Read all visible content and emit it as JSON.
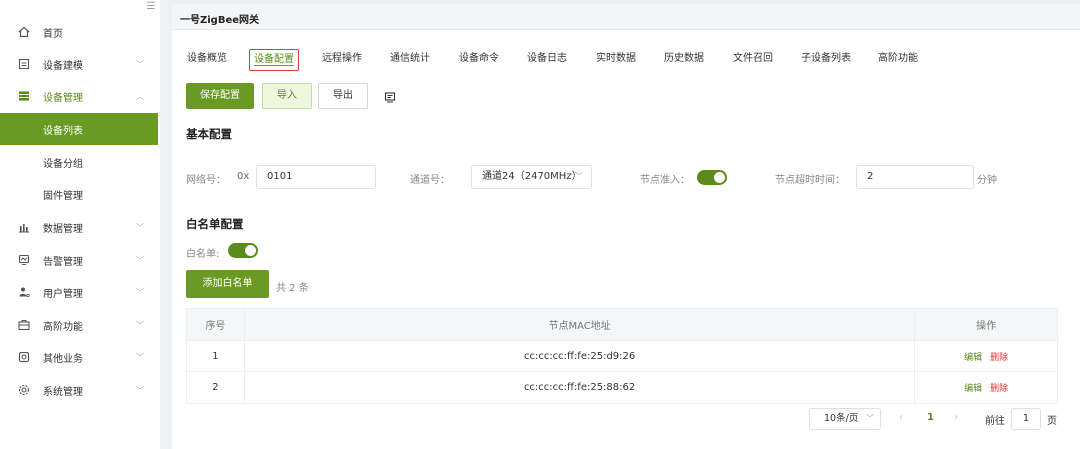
{
  "sidebar": {
    "collapse_glyph": "☰",
    "items": [
      {
        "label": "首页",
        "icon": "home-icon"
      },
      {
        "label": "设备建模",
        "icon": "model-icon"
      },
      {
        "label": "设备管理",
        "icon": "device-icon"
      },
      {
        "label": "数据管理",
        "icon": "chart-icon"
      },
      {
        "label": "告警管理",
        "icon": "alarm-icon"
      },
      {
        "label": "用户管理",
        "icon": "user-icon"
      },
      {
        "label": "高阶功能",
        "icon": "advanced-icon"
      },
      {
        "label": "其他业务",
        "icon": "other-icon"
      },
      {
        "label": "系统管理",
        "icon": "gear-icon"
      }
    ],
    "sub_items": [
      {
        "label": "设备列表"
      },
      {
        "label": "设备分组"
      },
      {
        "label": "固件管理"
      }
    ]
  },
  "main": {
    "title": "一号ZigBee网关",
    "tabs": [
      "设备概览",
      "设备配置",
      "远程操作",
      "通信统计",
      "设备命令",
      "设备日志",
      "实时数据",
      "历史数据",
      "文件召回",
      "子设备列表",
      "高阶功能"
    ],
    "toolbar": {
      "save_label": "保存配置",
      "import_label": "导入",
      "export_label": "导出"
    },
    "basic": {
      "title": "基本配置",
      "net_label": "网络号：",
      "net_prefix": "0x",
      "net_value": "0101",
      "channel_label": "通道号：",
      "channel_value": "通道24（2470MHz）",
      "access_label": "节点准入：",
      "access_on": true,
      "timeout_label": "节点超时时间：",
      "timeout_value": "2",
      "timeout_unit": "分钟"
    },
    "whitelist": {
      "title": "白名单配置",
      "switch_label": "白名单:",
      "switch_on": true,
      "add_label": "添加白名单",
      "count_text": "共 2 条",
      "columns": [
        "序号",
        "节点MAC地址",
        "操作"
      ],
      "rows": [
        {
          "index": "1",
          "mac": "cc:cc:cc:ff:fe:25:d9:26",
          "edit": "编辑",
          "delete": "删除"
        },
        {
          "index": "2",
          "mac": "cc:cc:cc:ff:fe:25:88:62",
          "edit": "编辑",
          "delete": "删除"
        }
      ]
    },
    "pagination": {
      "page_size": "10条/页",
      "current_page": "1",
      "goto_label": "前往",
      "goto_value": "1",
      "page_unit": "页"
    }
  },
  "colors": {
    "accent": "#6a9a23",
    "highlight_border": "#e53935",
    "delete": "#e53935"
  }
}
